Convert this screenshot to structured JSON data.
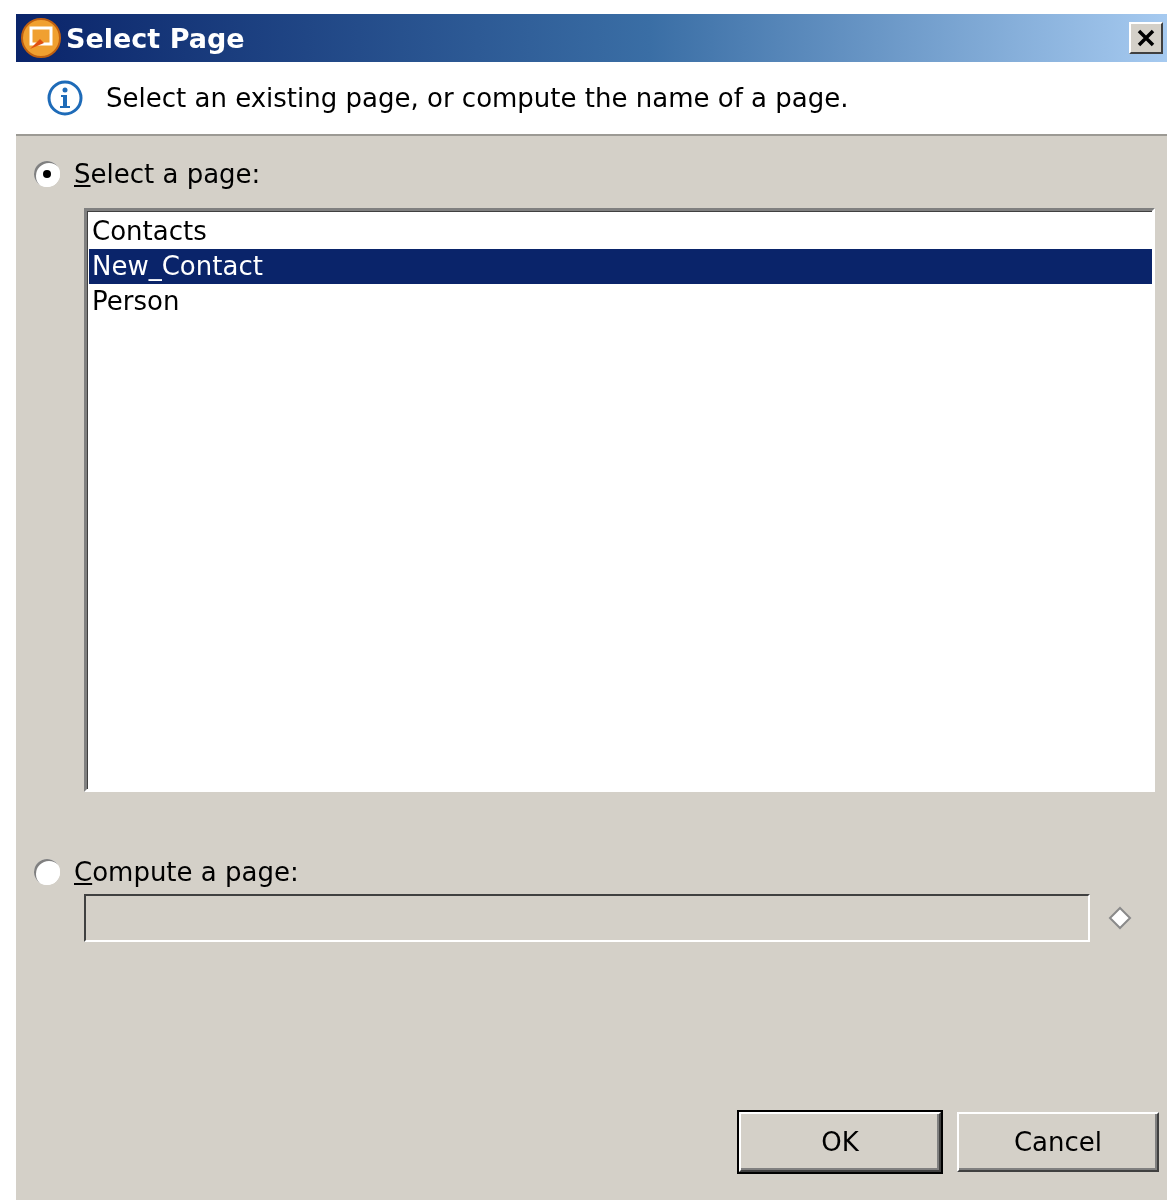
{
  "window": {
    "title": "Select Page"
  },
  "message": "Select an existing page, or compute the name of a page.",
  "options": [
    {
      "label": "Select a page:",
      "selected": true
    },
    {
      "label": "Compute a page:",
      "selected": false
    }
  ],
  "pages": [
    {
      "label": "Contacts",
      "selected": false
    },
    {
      "label": "New_Contact",
      "selected": true
    },
    {
      "label": "Person",
      "selected": false
    }
  ],
  "compute_field": {
    "disabled": true
  },
  "buttons": [
    {
      "label": "OK",
      "default": true
    },
    {
      "label": "Cancel",
      "default": false
    }
  ]
}
